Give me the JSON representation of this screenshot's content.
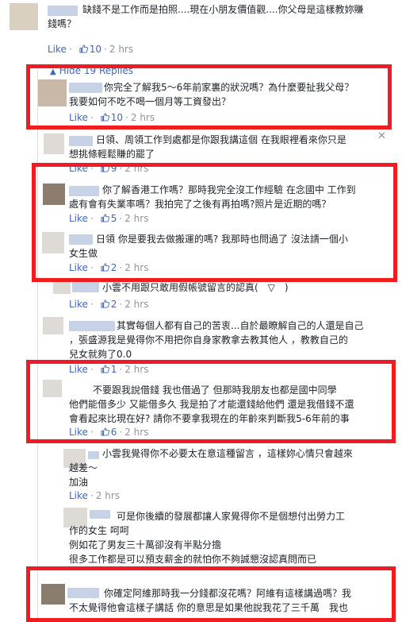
{
  "hide_replies": "Hide 19 Replies",
  "close_glyph": "✕",
  "comments": [
    {
      "lines": [
        "缺錢不是工作而是拍照....現在小朋友價值觀....你父母是這樣教妳賺",
        "錢嗎？"
      ],
      "likes": "10",
      "time": "2 hrs"
    },
    {
      "lines": [
        "你完全了解我5～6年前家裏的狀況嗎？為什麼要扯我父母？",
        "我要如何不吃不喝一個月等工資發出？"
      ],
      "likes": "10",
      "time": "2 hrs"
    },
    {
      "lines": [
        "日領、周領工作到處都是你跟我講這個 在我眼裡看來你只是",
        "想挑條輕鬆賺的罷了"
      ],
      "likes": "9",
      "time": "2 hrs"
    },
    {
      "lines": [
        "你了解香港工作嗎？那時我完全沒工作經驗 在念國中 工作到",
        "處有會有失業率嗎？我拍完了之後有再拍嗎?照片是近期的嗎？"
      ],
      "likes": "5",
      "time": "2 hrs"
    },
    {
      "lines": [
        "日領 你是要我去做搬運的嗎? 我那時也問過了 沒法請一個小",
        "女生做"
      ],
      "likes": "2",
      "time": "2 hrs"
    },
    {
      "lines": [
        "小雲不用跟只敢用假帳號留言的認真(　▽　)"
      ],
      "likes": "2",
      "time": "2 hrs"
    },
    {
      "lines": [
        "其實每個人都有自己的苦衷...自於最瞭解自己的人還是自己",
        "，張盛源我是覺得你不用把你自身家教拿去教其他人 ，教教自己的",
        "兒女就夠了0.0"
      ],
      "likes": "1",
      "time": "2 hrs"
    },
    {
      "lines": [
        "不要跟我說借錢 我也借過了 但那時我朋友也都是國中同學",
        "他們能借多少 又能借多久 我是拍了才能還錢給他們 還是我借錢不還",
        "會看起來比現在好? 請你不要拿我現在的年齡來判斷我5-6年前的事"
      ],
      "likes": "6",
      "time": "2 hrs"
    },
    {
      "lines": [
        "小雲我覺得你不必要太在意這種留言 ，這樣妳心情只會越來",
        "越差～",
        "加油"
      ],
      "likes": "",
      "time": "2 hrs"
    },
    {
      "lines": [
        "可是你後續的發展都讓人家覺得你不是個想付出勞力工",
        "作的女生 呵呵",
        "例如花了男友三十萬卻沒有半點分擔",
        "很多工作都是可以預支薪金的就怕你不夠誠懇沒認真問而已"
      ],
      "likes": "",
      "time": ""
    },
    {
      "lines": [
        "你確定阿維那時我一分錢都沒花嗎？阿維有這樣講過嗎？我",
        "不太覺得他會這樣子講話 你的意思是如果他說我花了三千萬　我也"
      ],
      "likes": "",
      "time": ""
    }
  ],
  "labels": {
    "like": "Like",
    "dot": "·"
  }
}
